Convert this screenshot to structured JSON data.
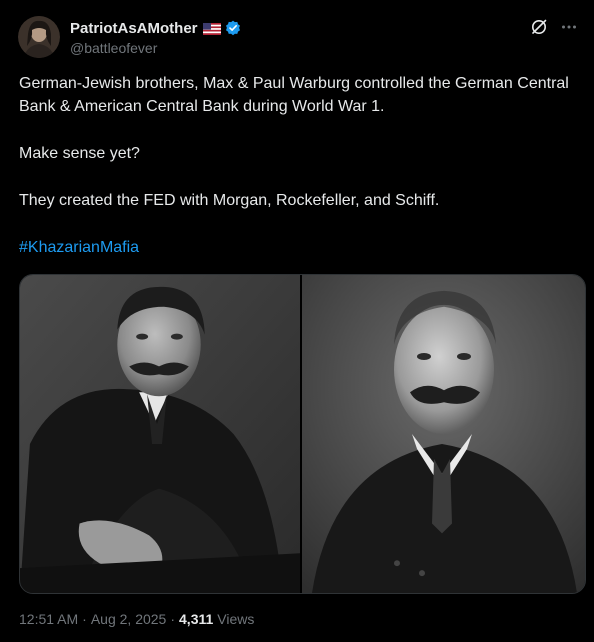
{
  "author": {
    "display_name": "PatriotAsAMother",
    "handle": "@battleofever",
    "flag_icon": "us-flag-icon",
    "verified_icon": "verified-badge-icon",
    "verified_color": "#1d9bf0"
  },
  "tweet": {
    "paragraph_1": "German-Jewish brothers, Max & Paul Warburg controlled the German Central Bank & American Central Bank during World War 1.",
    "paragraph_2": "Make sense yet?",
    "paragraph_3": "They created the FED with Morgan, Rockefeller, and Schiff.",
    "hashtag": "#KhazarianMafia",
    "hashtag_color": "#1d9bf0"
  },
  "media": {
    "images": [
      "black-and-white-portrait-left",
      "black-and-white-portrait-right"
    ]
  },
  "footer": {
    "time": "12:51 AM",
    "separator": "·",
    "date": "Aug 2, 2025",
    "views_count": "4,311",
    "views_label": "Views"
  },
  "icons": {
    "grok": "grok-icon",
    "more": "more-icon"
  }
}
